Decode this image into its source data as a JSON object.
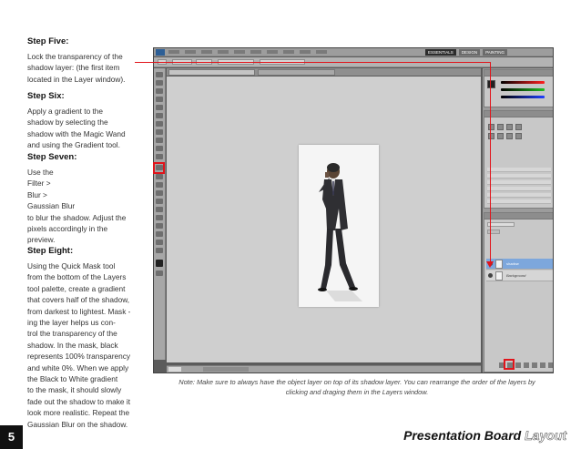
{
  "steps": [
    {
      "title": "Step Five:",
      "text": "Lock the transparency of the\nshadow layer: (the first item\nlocated in the Layer window)."
    },
    {
      "title": "Step Six:",
      "text": "Apply a gradient to the\nshadow by selecting the\nshadow with the Magic Wand\nand using the Gradient tool."
    },
    {
      "title": "Step Seven:",
      "text": "Use the\nFilter >\n           Blur >\n                     Gaussian Blur\nto blur the shadow. Adjust the\npixels accordingly in the\npreview."
    },
    {
      "title": "Step Eight:",
      "text": "Using the Quick Mask tool\nfrom the bottom of the Layers\ntool palette, create a gradient\nthat covers half of the shadow,\nfrom darkest to lightest. Mask -\ning the layer helps us con-\ntrol the transparency of the\nshadow. In the mask, black\nrepresents 100% transparency\nand white 0%. When we apply\nthe Black to White gradient\nto the mask, it should slowly\nfade out the shadow to make it\nlook more realistic. Repeat the\nGaussian Blur on the shadow."
    }
  ],
  "screenshot": {
    "workspace_tabs": [
      "ESSENTIALS",
      "DESIGN",
      "PAINTING"
    ],
    "layers": [
      {
        "name": "shadow",
        "selected": true
      },
      {
        "name": "Background",
        "selected": false
      }
    ],
    "colors": {
      "accent_red": "#e1141b",
      "selected_layer": "#7da7dc"
    }
  },
  "note": "Note: Make sure to always have the object layer on top of its shadow layer. You can rearrange the order of the layers by clicking and draging them in the Layers window.",
  "footer": {
    "page_number": "5",
    "title_main": "Presentation Board",
    "title_faded": "Layout"
  }
}
